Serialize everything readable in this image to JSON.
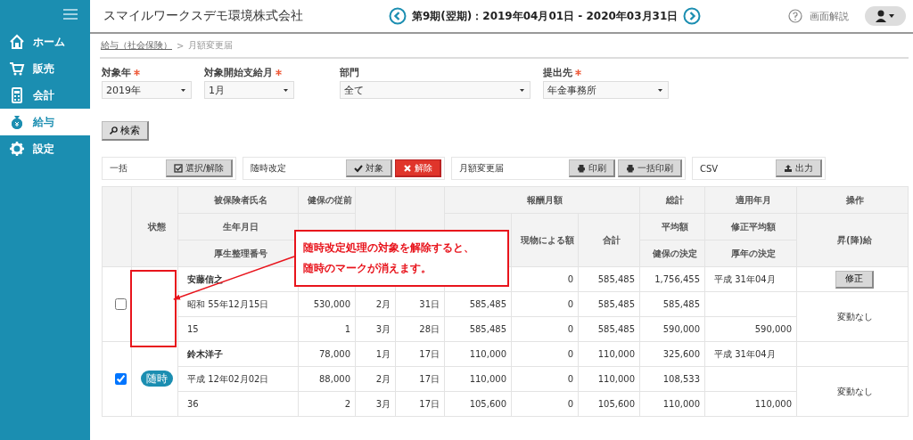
{
  "sidebar": {
    "items": [
      {
        "label": "ホーム",
        "selected": false
      },
      {
        "label": "販売",
        "selected": false
      },
      {
        "label": "会計",
        "selected": false
      },
      {
        "label": "給与",
        "selected": true
      },
      {
        "label": "設定",
        "selected": false
      }
    ]
  },
  "header": {
    "company": "スマイルワークスデモ環境株式会社",
    "period": "第9期(翌期)：2019年04月01日 - 2020年03月31日",
    "help": "画面解説"
  },
  "breadcrumb": {
    "link": "給与（社会保険）",
    "separator": ">",
    "current": "月額変更届"
  },
  "filters": [
    {
      "label": "対象年",
      "required": true,
      "value": "2019年"
    },
    {
      "label": "対象開始支給月",
      "required": true,
      "value": "1月"
    },
    {
      "label": "部門",
      "required": false,
      "value": "全て"
    },
    {
      "label": "提出先",
      "required": true,
      "value": "年金事務所"
    }
  ],
  "search_button": "検索",
  "action_groups": [
    {
      "label": "一括",
      "buttons": [
        {
          "label": "選択/解除",
          "kind": "normal"
        }
      ]
    },
    {
      "label": "随時改定",
      "buttons": [
        {
          "label": "対象",
          "kind": "normal"
        },
        {
          "label": "解除",
          "kind": "danger"
        }
      ]
    },
    {
      "label": "月額変更届",
      "buttons": [
        {
          "label": "印刷",
          "kind": "normal"
        },
        {
          "label": "一括印刷",
          "kind": "normal"
        }
      ]
    },
    {
      "label": "CSV",
      "buttons": [
        {
          "label": "出力",
          "kind": "normal"
        }
      ]
    }
  ],
  "table": {
    "columns": {
      "status": "状態",
      "name": "被保険者氏名",
      "birth": "生年月日",
      "number": "厚生整理番号",
      "health_prev": "健保の従前",
      "remuneration": "報酬月額",
      "in_kind": "現物による額",
      "total": "合計",
      "grand_total": "総計",
      "average": "平均額",
      "health_decision": "健保の決定",
      "applied": "適用年月",
      "corrected_average": "修正平均額",
      "pension_decision": "厚年の決定",
      "operation": "操作",
      "raise": "昇(降)給"
    },
    "employees": [
      {
        "checked": false,
        "action_button": "修正",
        "raise": "変動なし",
        "rows": [
          {
            "label": "安藤信之",
            "in_kind": "0",
            "total": "585,485",
            "summary": "1,756,455",
            "applied": "平成 31年04月"
          },
          {
            "label": "昭和 55年12月15日",
            "prev": "530,000",
            "month": "2月",
            "days": "31日",
            "cash": "585,485",
            "in_kind": "0",
            "total": "585,485",
            "summary": "585,485"
          },
          {
            "label": "15",
            "prev": "1",
            "month": "3月",
            "days": "28日",
            "cash": "585,485",
            "in_kind": "0",
            "total": "585,485",
            "summary": "590,000",
            "applied": "590,000"
          }
        ]
      },
      {
        "checked": true,
        "badge": "随時",
        "raise": "変動なし",
        "rows": [
          {
            "label": "鈴木洋子",
            "prev": "78,000",
            "month": "1月",
            "days": "17日",
            "cash": "110,000",
            "in_kind": "0",
            "total": "110,000",
            "summary": "325,600",
            "applied": "平成 31年04月"
          },
          {
            "label": "平成 12年02月02日",
            "prev": "88,000",
            "month": "2月",
            "days": "17日",
            "cash": "110,000",
            "in_kind": "0",
            "total": "110,000",
            "summary": "108,533"
          },
          {
            "label": "36",
            "prev": "2",
            "month": "3月",
            "days": "17日",
            "cash": "105,600",
            "in_kind": "0",
            "total": "105,600",
            "summary": "110,000",
            "applied": "110,000"
          }
        ]
      }
    ]
  },
  "callout": {
    "lines": [
      "随時改定処理の対象を解除すると、",
      "随時のマークが消えます。"
    ]
  }
}
